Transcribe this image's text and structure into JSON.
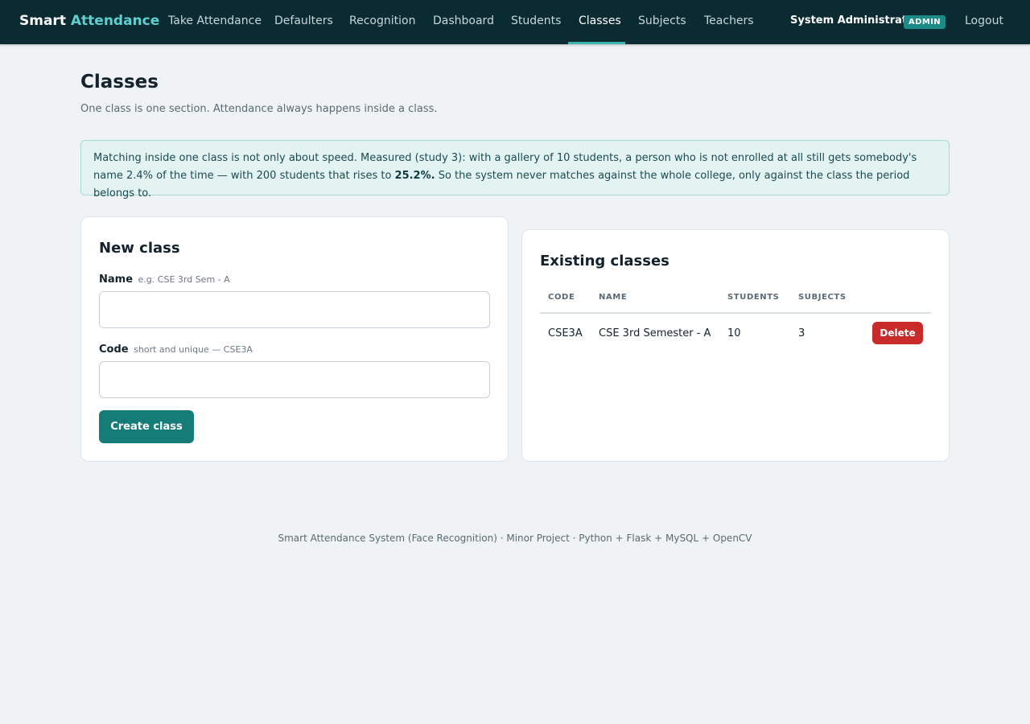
{
  "brand": {
    "part1": "Smart",
    "part2": "Attendance"
  },
  "nav": {
    "items": [
      {
        "label": "Take Attendance"
      },
      {
        "label": "Defaulters"
      },
      {
        "label": "Recognition"
      },
      {
        "label": "Dashboard"
      },
      {
        "label": "Students"
      },
      {
        "label": "Classes",
        "active": true
      },
      {
        "label": "Subjects"
      },
      {
        "label": "Teachers"
      }
    ],
    "user_name": "System Administrator",
    "role_badge": "ADMIN",
    "logout_label": "Logout"
  },
  "page": {
    "title": "Classes",
    "subtitle": "One class is one section. Attendance always happens inside a class."
  },
  "info": {
    "text_before": "Matching inside one class is not only about speed. Measured (study 3): with a gallery of 10 students, a person who is not enrolled at all still gets somebody's name 2.4% of the time — with 200 students that rises to ",
    "highlight": "25.2%.",
    "text_after": " So the system never matches against the whole college, only against the class the period belongs to."
  },
  "new_class": {
    "heading": "New class",
    "name_label": "Name",
    "name_hint": "e.g. CSE 3rd Sem - A",
    "name_value": "",
    "code_label": "Code",
    "code_hint": "short and unique — CSE3A",
    "code_value": "",
    "submit_label": "Create class"
  },
  "existing": {
    "heading": "Existing classes",
    "columns": [
      "CODE",
      "NAME",
      "STUDENTS",
      "SUBJECTS"
    ],
    "rows": [
      {
        "code": "CSE3A",
        "name": "CSE 3rd Semester - A",
        "students": "10",
        "subjects": "3",
        "action": "Delete"
      }
    ]
  },
  "footer": "Smart Attendance System (Face Recognition) · Minor Project · Python + Flask + MySQL + OpenCV",
  "colors": {
    "navbar_bg": "#0b2b33",
    "brand_accent": "#5fd0d0",
    "primary": "#157c77",
    "danger": "#c92a2a",
    "info_bg": "#e3f3f1"
  }
}
